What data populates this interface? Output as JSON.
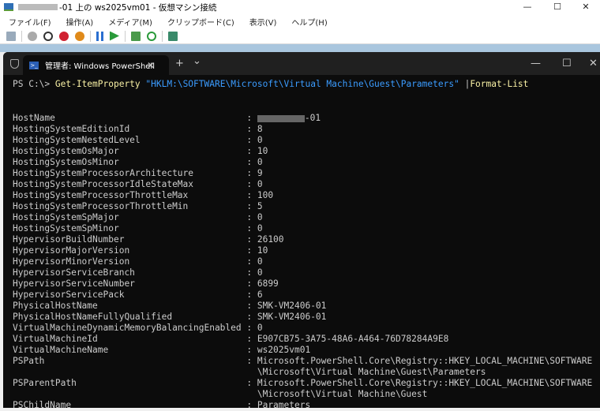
{
  "window": {
    "title": "-01 上の ws2025vm01  - 仮想マシン接続",
    "min": "—",
    "max": "☐",
    "close": "✕"
  },
  "menu": [
    "ファイル(F)",
    "操作(A)",
    "メディア(M)",
    "クリップボード(C)",
    "表示(V)",
    "ヘルプ(H)"
  ],
  "terminal": {
    "tab_title": "管理者: Windows PowerShell",
    "tab_close": "✕",
    "new_tab": "+",
    "dropdown": "⌄",
    "min": "—",
    "max": "☐",
    "close": "✕",
    "prompt": "PS C:\\> ",
    "cmdlet": "Get-ItemProperty",
    "path": "\"HKLM:\\SOFTWARE\\Microsoft\\Virtual Machine\\Guest\\Parameters\"",
    "pipe": " |",
    "format": "Format-List",
    "properties": [
      {
        "name": "HostName",
        "value": "-01"
      },
      {
        "name": "HostingSystemEditionId",
        "value": "8"
      },
      {
        "name": "HostingSystemNestedLevel",
        "value": "0"
      },
      {
        "name": "HostingSystemOsMajor",
        "value": "10"
      },
      {
        "name": "HostingSystemOsMinor",
        "value": "0"
      },
      {
        "name": "HostingSystemProcessorArchitecture",
        "value": "9"
      },
      {
        "name": "HostingSystemProcessorIdleStateMax",
        "value": "0"
      },
      {
        "name": "HostingSystemProcessorThrottleMax",
        "value": "100"
      },
      {
        "name": "HostingSystemProcessorThrottleMin",
        "value": "5"
      },
      {
        "name": "HostingSystemSpMajor",
        "value": "0"
      },
      {
        "name": "HostingSystemSpMinor",
        "value": "0"
      },
      {
        "name": "HypervisorBuildNumber",
        "value": "26100"
      },
      {
        "name": "HypervisorMajorVersion",
        "value": "10"
      },
      {
        "name": "HypervisorMinorVersion",
        "value": "0"
      },
      {
        "name": "HypervisorServiceBranch",
        "value": "0"
      },
      {
        "name": "HypervisorServiceNumber",
        "value": "6899"
      },
      {
        "name": "HypervisorServicePack",
        "value": "6"
      },
      {
        "name": "PhysicalHostName",
        "value": "SMK-VM2406-01"
      },
      {
        "name": "PhysicalHostNameFullyQualified",
        "value": "SMK-VM2406-01"
      },
      {
        "name": "VirtualMachineDynamicMemoryBalancingEnabled",
        "value": "0"
      },
      {
        "name": "VirtualMachineId",
        "value": "E907CB75-3A75-48A6-A464-76D78284A9E8"
      },
      {
        "name": "VirtualMachineName",
        "value": "ws2025vm01"
      },
      {
        "name": "PSPath",
        "value": "Microsoft.PowerShell.Core\\Registry::HKEY_LOCAL_MACHINE\\SOFTWARE\n\\Microsoft\\Virtual Machine\\Guest\\Parameters"
      },
      {
        "name": "PSParentPath",
        "value": "Microsoft.PowerShell.Core\\Registry::HKEY_LOCAL_MACHINE\\SOFTWARE\n\\Microsoft\\Virtual Machine\\Guest"
      },
      {
        "name": "PSChildName",
        "value": "Parameters"
      }
    ]
  }
}
